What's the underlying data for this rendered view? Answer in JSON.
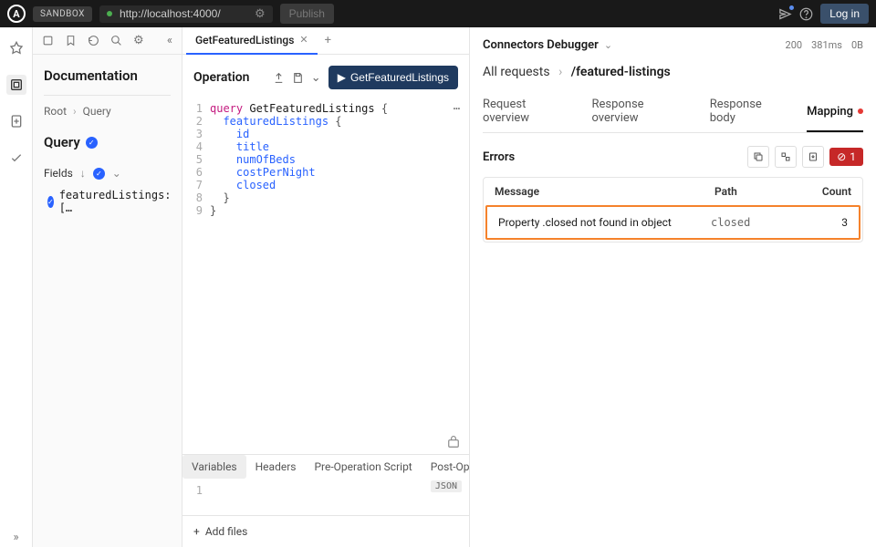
{
  "topbar": {
    "sandbox_label": "SANDBOX",
    "url": "http://localhost:4000/",
    "publish_label": "Publish",
    "login_label": "Log in"
  },
  "doc": {
    "title": "Documentation",
    "breadcrumb_root": "Root",
    "breadcrumb_current": "Query",
    "query_heading": "Query",
    "fields_label": "Fields",
    "field_item": "featuredListings: […"
  },
  "tabs": {
    "active": "GetFeaturedListings"
  },
  "operation": {
    "title": "Operation",
    "run_label": "GetFeaturedListings",
    "lines": [
      {
        "n": "1",
        "html": "<span class='kw'>query</span> <span class='name'>GetFeaturedListings</span> <span class='brace'>{</span>"
      },
      {
        "n": "2",
        "html": "  <span class='field'>featuredListings</span> <span class='brace'>{</span>"
      },
      {
        "n": "3",
        "html": "    <span class='field'>id</span>"
      },
      {
        "n": "4",
        "html": "    <span class='field'>title</span>"
      },
      {
        "n": "5",
        "html": "    <span class='field'>numOfBeds</span>"
      },
      {
        "n": "6",
        "html": "    <span class='field'>costPerNight</span>"
      },
      {
        "n": "7",
        "html": "    <span class='field'>closed</span>"
      },
      {
        "n": "8",
        "html": "  <span class='brace'>}</span>"
      },
      {
        "n": "9",
        "html": "<span class='brace'>}</span>"
      }
    ]
  },
  "bottom_tabs": {
    "variables": "Variables",
    "headers": "Headers",
    "preop": "Pre-Operation Script",
    "postop": "Post-Operation Scri",
    "json_badge": "JSON",
    "line_no": "1",
    "add_files": "Add files"
  },
  "debugger": {
    "title": "Connectors Debugger",
    "status_code": "200",
    "latency": "381ms",
    "size": "0B",
    "all_requests": "All requests",
    "current_request": "/featured-listings",
    "tabs": {
      "req_overview": "Request overview",
      "res_overview": "Response overview",
      "res_body": "Response body",
      "mapping": "Mapping"
    },
    "errors_title": "Errors",
    "error_count": "1",
    "table": {
      "col_message": "Message",
      "col_path": "Path",
      "col_count": "Count",
      "row": {
        "message": "Property .closed not found in object",
        "path": "closed",
        "count": "3"
      }
    }
  }
}
